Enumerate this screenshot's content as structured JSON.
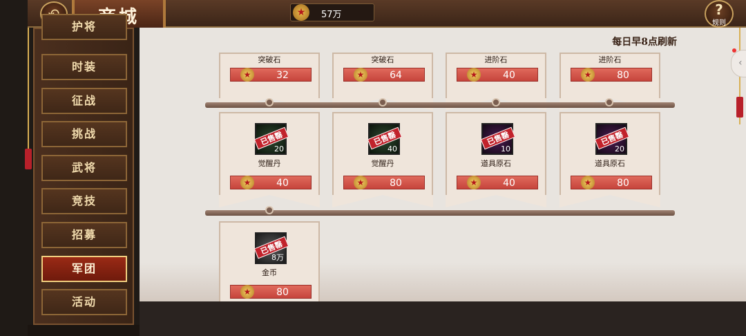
{
  "header": {
    "back_label": "",
    "title": "商城",
    "currency_value": "57万",
    "rules_label": "规则"
  },
  "main": {
    "refresh_note": "每日早8点刷新"
  },
  "sidebar": {
    "items": [
      {
        "label": "护将",
        "active": false
      },
      {
        "label": "时装",
        "active": false
      },
      {
        "label": "征战",
        "active": false
      },
      {
        "label": "挑战",
        "active": false
      },
      {
        "label": "武将",
        "active": false
      },
      {
        "label": "竞技",
        "active": false
      },
      {
        "label": "招募",
        "active": false
      },
      {
        "label": "军团",
        "active": true
      },
      {
        "label": "活动",
        "active": false
      }
    ]
  },
  "shop": {
    "row1": [
      {
        "name": "突破石",
        "price": "32"
      },
      {
        "name": "突破石",
        "price": "64"
      },
      {
        "name": "进阶石",
        "price": "40"
      },
      {
        "name": "进阶石",
        "price": "80"
      }
    ],
    "row2": [
      {
        "name": "觉醒丹",
        "price": "40",
        "count": "20",
        "sold": "已售罄"
      },
      {
        "name": "觉醒丹",
        "price": "80",
        "count": "40",
        "sold": "已售罄"
      },
      {
        "name": "道具原石",
        "price": "40",
        "count": "10",
        "sold": "已售罄"
      },
      {
        "name": "道具原石",
        "price": "80",
        "count": "20",
        "sold": "已售罄"
      }
    ],
    "row3": [
      {
        "name": "金币",
        "price": "80",
        "count": "8万",
        "sold": "已售罄"
      }
    ]
  },
  "icons": {
    "back": "back-arrow-icon",
    "currency": "army-star-icon",
    "rules": "question-icon"
  },
  "colors": {
    "accent_red": "#c6443c",
    "sidebar_active": "#9a2a15",
    "gold": "#c9a25f"
  }
}
